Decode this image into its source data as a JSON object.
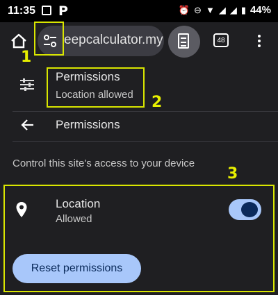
{
  "status_bar": {
    "time": "11:35",
    "battery": "44%"
  },
  "browser": {
    "url": "eepcalculator.my",
    "tab_count": "48"
  },
  "site_settings": {
    "permissions_title": "Permissions",
    "permissions_subtitle": "Location allowed",
    "back_title": "Permissions",
    "description": "Control this site's access to your device",
    "location_label": "Location",
    "location_status": "Allowed",
    "location_toggle_on": true,
    "reset_button": "Reset permissions"
  },
  "annotations": {
    "n1": "1",
    "n2": "2",
    "n3": "3",
    "color": "#d9e600"
  },
  "colors": {
    "accent": "#a8c7fa",
    "toggle_knob": "#0b2a5b",
    "page_bg": "#1f1f22"
  }
}
